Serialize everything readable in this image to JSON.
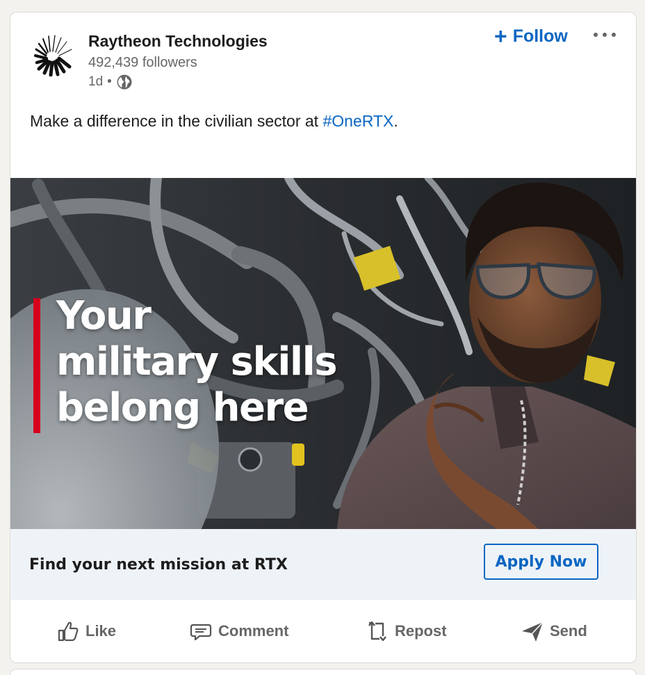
{
  "post": {
    "company_name": "Raytheon Technologies",
    "followers": "492,439 followers",
    "age": "1d",
    "separator": "•",
    "follow_label": "Follow",
    "follow_icon": "plus-icon",
    "more_icon": "more-options-icon",
    "visibility_icon": "globe-icon",
    "text_prefix": "Make a difference in the civilian sector at ",
    "hashtag": "#OneRTX",
    "text_suffix": "."
  },
  "ad": {
    "headline_line1": "Your",
    "headline_line2": "military skills",
    "headline_line3": "belong here",
    "cta_text": "Find your next mission at RTX",
    "apply_label": "Apply Now"
  },
  "actions": [
    {
      "label": "Like",
      "icon": "thumbs-up-icon"
    },
    {
      "label": "Comment",
      "icon": "comment-icon"
    },
    {
      "label": "Repost",
      "icon": "repost-icon"
    },
    {
      "label": "Send",
      "icon": "send-icon"
    }
  ],
  "colors": {
    "link_blue": "#0a66c2",
    "accent_red": "#d6001c",
    "cta_bar_bg": "#eef3f8"
  }
}
